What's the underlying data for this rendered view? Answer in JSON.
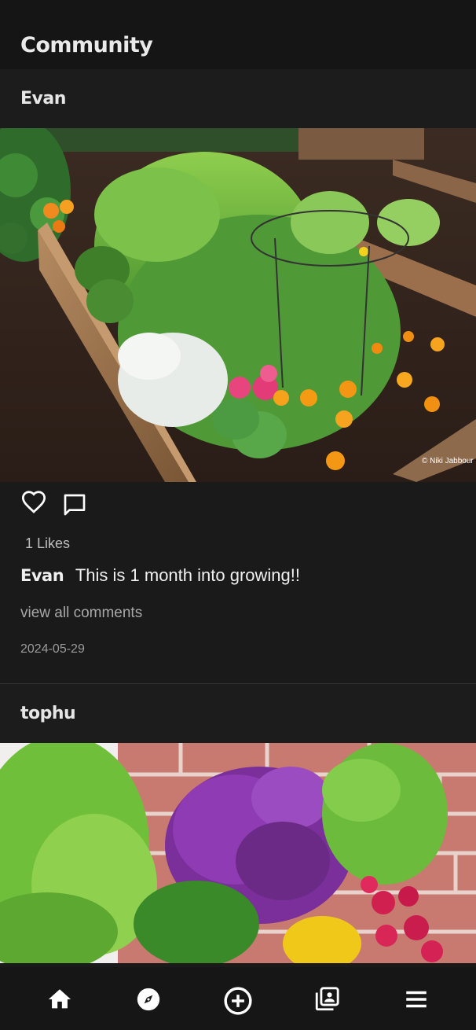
{
  "header": {
    "title": "Community"
  },
  "posts": [
    {
      "username": "Evan",
      "likes_text": "1 Likes",
      "caption_user": "Evan",
      "caption_text": "This is 1 month into growing!!",
      "view_comments": "view all comments",
      "date": "2024-05-29",
      "image_watermark": "© Niki Jabbour"
    },
    {
      "username": "tophu"
    }
  ],
  "icons": {
    "like": "heart-icon",
    "comment": "comment-icon"
  },
  "bottom_nav": [
    {
      "name": "home",
      "icon": "home-icon"
    },
    {
      "name": "explore",
      "icon": "compass-icon"
    },
    {
      "name": "create",
      "icon": "plus-circle-icon"
    },
    {
      "name": "gallery",
      "icon": "photo-library-icon"
    },
    {
      "name": "menu",
      "icon": "menu-icon"
    }
  ],
  "colors": {
    "background": "#1a1a1a",
    "topbar": "#151515",
    "nav": "#161616",
    "icon": "#ffffff"
  }
}
